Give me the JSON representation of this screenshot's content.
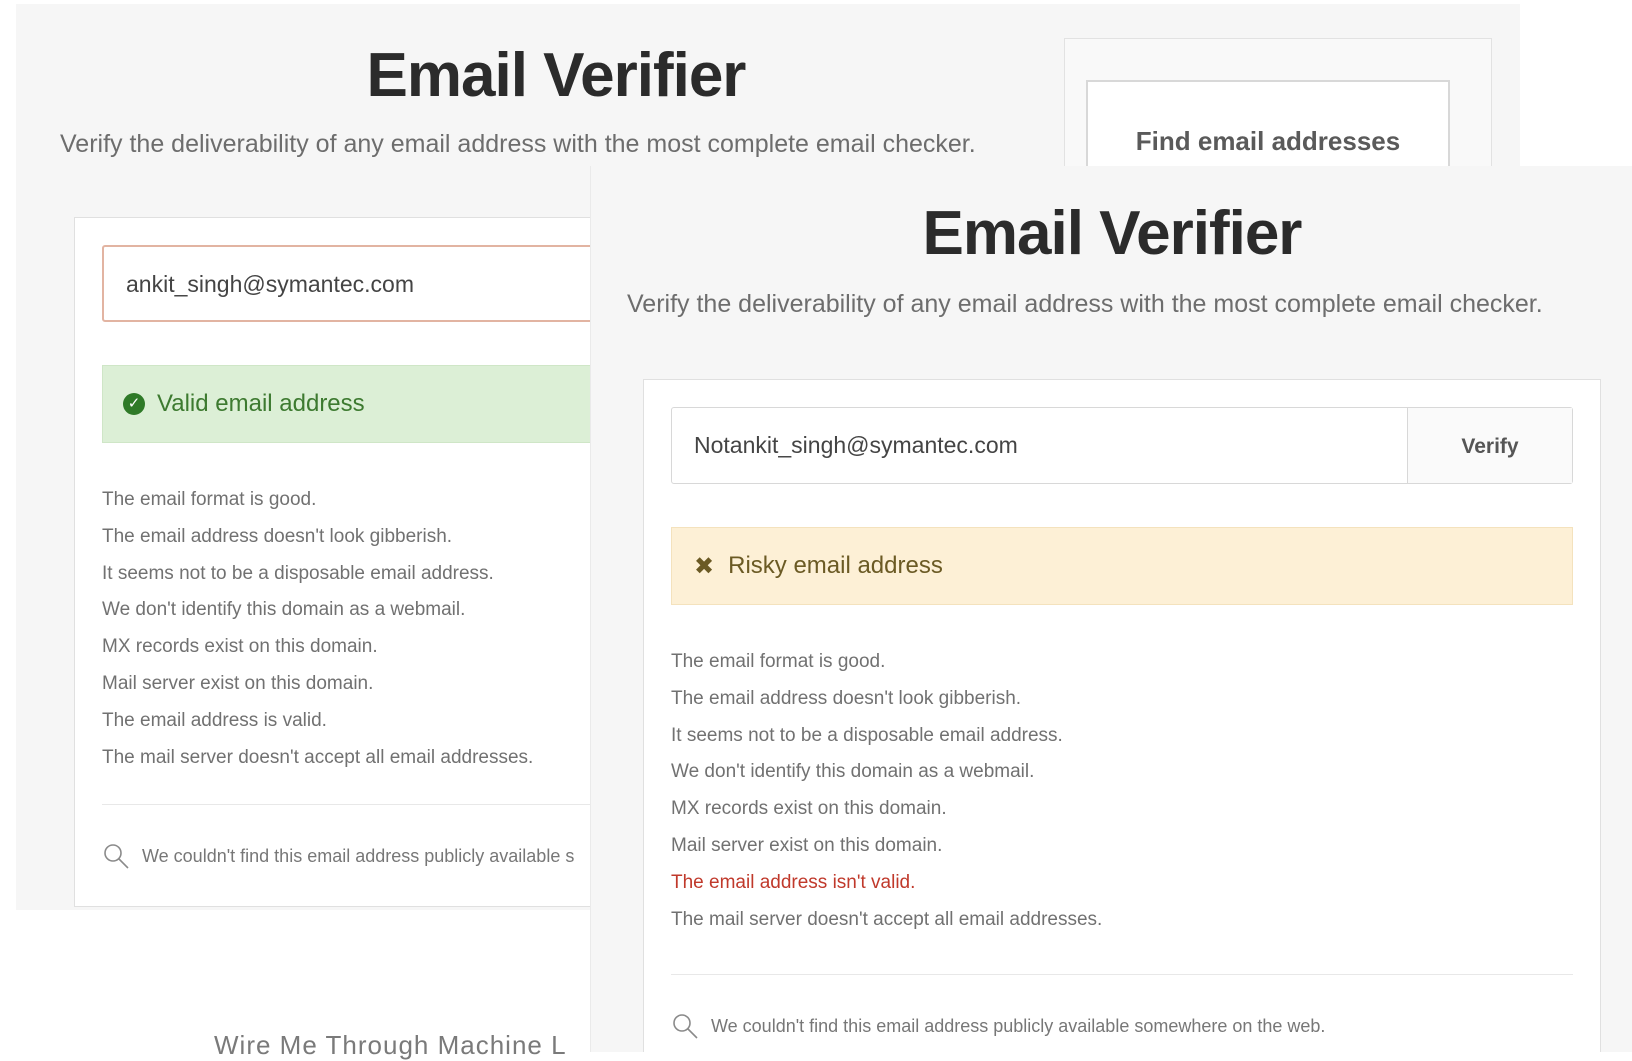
{
  "back": {
    "title": "Email Verifier",
    "subtitle": "Verify the deliverability of any email address with the most complete email checker.",
    "find_button": "Find email addresses",
    "email_value": "ankit_singh@symantec.com",
    "status": "Valid email address",
    "checks": [
      "The email format is good.",
      "The email address doesn't look gibberish.",
      "It seems not to be a disposable email address.",
      "We don't identify this domain as a webmail.",
      "MX records exist on this domain.",
      "Mail server exist on this domain.",
      "The email address is valid.",
      "The mail server doesn't accept all email addresses."
    ],
    "web_note": "We couldn't find this email address publicly available s"
  },
  "front": {
    "title": "Email Verifier",
    "subtitle": "Verify the deliverability of any email address with the most complete email checker.",
    "email_value": "Notankit_singh@symantec.com",
    "verify_label": "Verify",
    "status": "Risky email address",
    "checks": [
      "The email format is good.",
      "The email address doesn't look gibberish.",
      "It seems not to be a disposable email address.",
      "We don't identify this domain as a webmail.",
      "MX records exist on this domain.",
      "Mail server exist on this domain.",
      "The email address isn't valid.",
      "The mail server doesn't accept all email addresses."
    ],
    "web_note": "We couldn't find this email address publicly available somewhere on the web."
  },
  "underlying_text": "Wire Me Through Machine L",
  "colors": {
    "valid_bg": "#dcefd6",
    "valid_text": "#3d7a30",
    "risky_bg": "#fdf0d6",
    "risky_text": "#6b5a24",
    "error_text": "#c0392b"
  },
  "icons": {
    "valid": "check-circle-icon",
    "risky": "x-mark-icon",
    "search": "magnifier-icon"
  }
}
